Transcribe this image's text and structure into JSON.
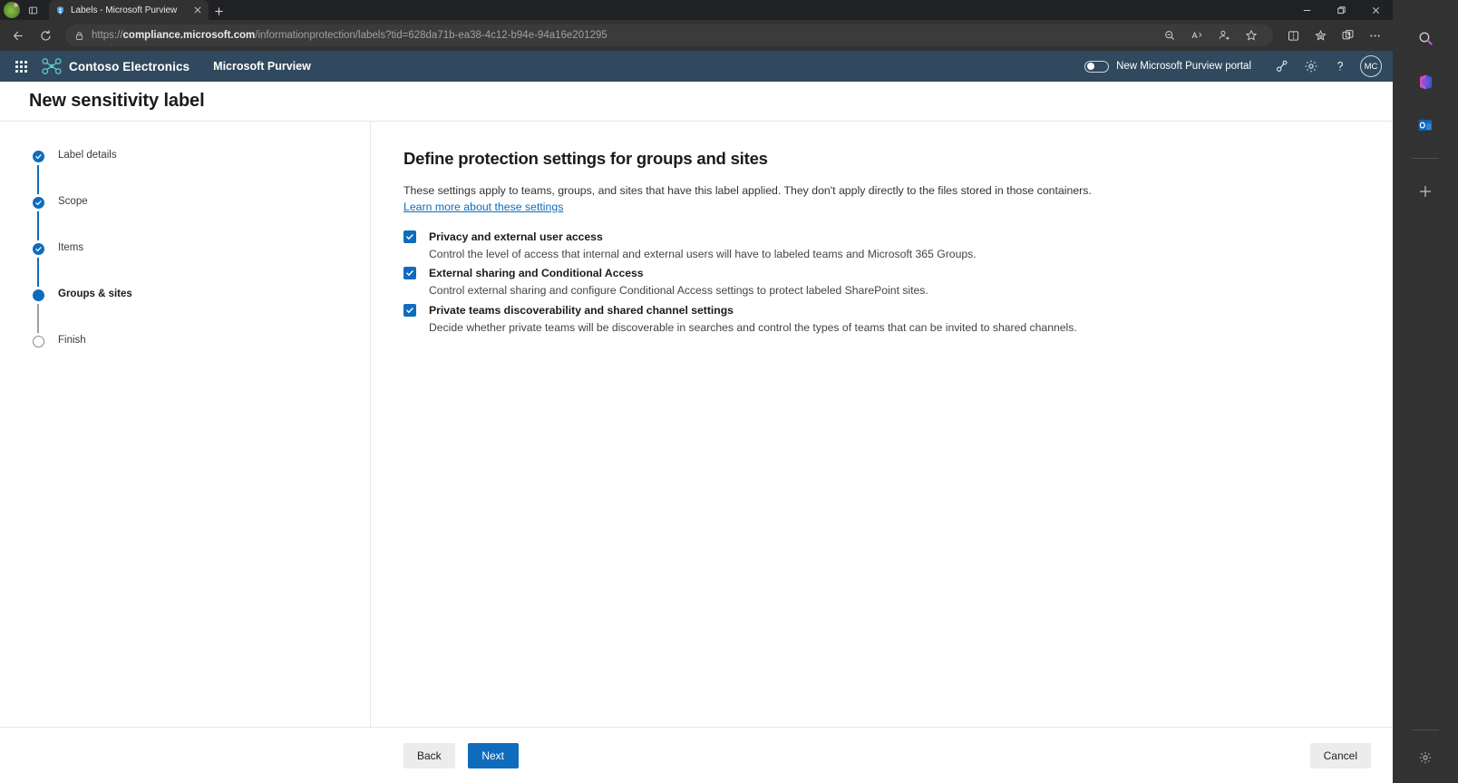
{
  "browser": {
    "tab": {
      "title": "Labels - Microsoft Purview",
      "favicon_icon": "shield-icon",
      "close_icon": "close-icon"
    },
    "new_tab_icon": "plus-icon",
    "tab_list_icon": "tab-list-icon",
    "profile_icon": "profile-avatar-plant-icon",
    "window": {
      "minimize_icon": "minimize-icon",
      "restore_icon": "restore-icon",
      "close_icon": "close-icon"
    },
    "nav": {
      "back_icon": "arrow-left-icon",
      "reload_icon": "reload-icon"
    },
    "address": {
      "lock_icon": "lock-icon",
      "url_scheme": "https://",
      "url_host": "compliance.microsoft.com",
      "url_path": "/informationprotection/labels?tid=628da71b-ea38-4c12-b94e-94a16e201295",
      "url_full": "https://compliance.microsoft.com/informationprotection/labels?tid=628da71b-ea38-4c12-b94e-94a16e201295"
    },
    "toolbar_icons": [
      "zoom-out-icon",
      "read-aloud-icon",
      "profile-add-icon",
      "favorite-star-icon",
      "split-screen-icon",
      "collections-icon",
      "browser-essentials-icon",
      "more-options-icon"
    ],
    "rail_icons": [
      "copilot-search-icon",
      "microsoft-365-icon",
      "outlook-icon",
      "add-sidebar-icon",
      "sidebar-settings-gear-icon"
    ]
  },
  "purview": {
    "waffle_icon": "app-launcher-waffle-icon",
    "brand_logo_icon": "contoso-drone-logo-icon",
    "brand": "Contoso Electronics",
    "app_name": "Microsoft Purview",
    "toggle": {
      "label": "New Microsoft Purview portal",
      "state": "off"
    },
    "icons": [
      "diagnostics-icon",
      "settings-gear-icon",
      "help-question-icon"
    ],
    "avatar_initials": "MC",
    "accent_color": "#0f6cbd",
    "header_color": "#31495e"
  },
  "page": {
    "title": "New sensitivity label"
  },
  "wizard": {
    "steps": [
      {
        "label": "Label details",
        "state": "done"
      },
      {
        "label": "Scope",
        "state": "done"
      },
      {
        "label": "Items",
        "state": "done"
      },
      {
        "label": "Groups & sites",
        "state": "current"
      },
      {
        "label": "Finish",
        "state": "todo"
      }
    ]
  },
  "main": {
    "heading": "Define protection settings for groups and sites",
    "description": "These settings apply to teams, groups, and sites that have this label applied. They don't apply directly to the files stored in those containers.",
    "link": "Learn more about these settings",
    "options": [
      {
        "title": "Privacy and external user access",
        "description": "Control the level of access that internal and external users will have to labeled teams and Microsoft 365 Groups.",
        "checked": true
      },
      {
        "title": "External sharing and Conditional Access",
        "description": "Control external sharing and configure Conditional Access settings to protect labeled SharePoint sites.",
        "checked": true
      },
      {
        "title": "Private teams discoverability and shared channel settings",
        "description": "Decide whether private teams will be discoverable in searches and control the types of teams that can be invited to shared channels.",
        "checked": true
      }
    ]
  },
  "footer": {
    "back": "Back",
    "next": "Next",
    "cancel": "Cancel"
  }
}
